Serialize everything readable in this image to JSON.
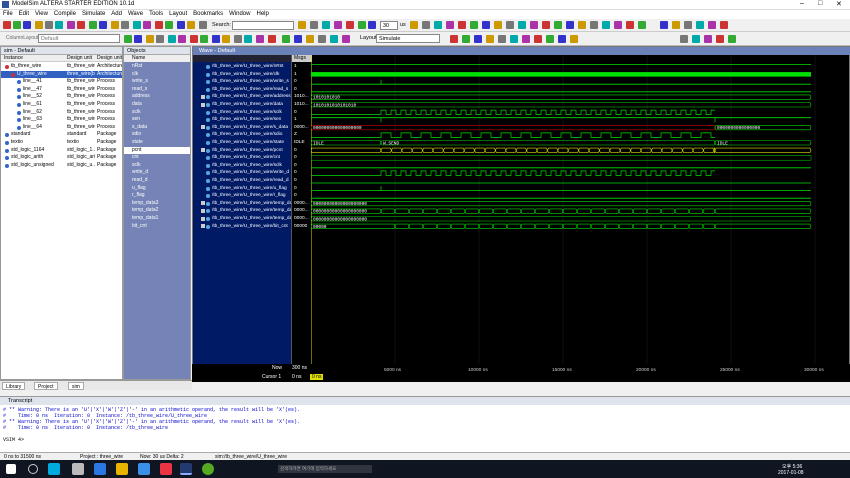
{
  "window": {
    "title": "ModelSim ALTERA STARTER EDITION 10.1d"
  },
  "menu": [
    "File",
    "Edit",
    "View",
    "Compile",
    "Simulate",
    "Add",
    "Wave",
    "Tools",
    "Layout",
    "Bookmarks",
    "Window",
    "Help"
  ],
  "toolbar": {
    "search_label": "Search:",
    "run_length": "30",
    "run_unit": "us",
    "column_layout": "ColumnLayout",
    "column_layout_value": "Default",
    "layout_label": "Layout",
    "layout_value": "Simulate"
  },
  "sim_panel": {
    "title": "sim - Default",
    "headers": [
      "Instance",
      "Design unit",
      "Design unit type"
    ],
    "rows": [
      {
        "name": "tb_three_wire",
        "unit": "tb_three_wire",
        "type": "Architecture",
        "indent": 0,
        "selected": false
      },
      {
        "name": "U_three_wire",
        "unit": "three_wire(b...",
        "type": "Architecture",
        "indent": 1,
        "selected": true
      },
      {
        "name": "line__41",
        "unit": "tb_three_wire",
        "type": "Process",
        "indent": 2,
        "selected": false
      },
      {
        "name": "line__47",
        "unit": "tb_three_wire",
        "type": "Process",
        "indent": 2,
        "selected": false
      },
      {
        "name": "line__52",
        "unit": "tb_three_wire",
        "type": "Process",
        "indent": 2,
        "selected": false
      },
      {
        "name": "line__61",
        "unit": "tb_three_wire",
        "type": "Process",
        "indent": 2,
        "selected": false
      },
      {
        "name": "line__62",
        "unit": "tb_three_wire",
        "type": "Process",
        "indent": 2,
        "selected": false
      },
      {
        "name": "line__63",
        "unit": "tb_three_wire",
        "type": "Process",
        "indent": 2,
        "selected": false
      },
      {
        "name": "line__64",
        "unit": "tb_three_wire",
        "type": "Process",
        "indent": 2,
        "selected": false
      },
      {
        "name": "standard",
        "unit": "standard",
        "type": "Package",
        "indent": 0,
        "selected": false
      },
      {
        "name": "textio",
        "unit": "textio",
        "type": "Package",
        "indent": 0,
        "selected": false
      },
      {
        "name": "std_logic_1164",
        "unit": "std_logic_1...",
        "type": "Package",
        "indent": 0,
        "selected": false
      },
      {
        "name": "std_logic_arith",
        "unit": "std_logic_arith",
        "type": "Package",
        "indent": 0,
        "selected": false
      },
      {
        "name": "std_logic_unsigned",
        "unit": "std_logic_u...",
        "type": "Package",
        "indent": 0,
        "selected": false
      }
    ],
    "tabs": [
      "Library",
      "Project",
      "sim"
    ]
  },
  "objects_panel": {
    "title": "Objects",
    "header": "Name",
    "items": [
      "nRst",
      "clk",
      "write_s",
      "read_s",
      "address",
      "data",
      "sclk",
      "sen",
      "s_data",
      "sdio",
      "state",
      "pcnt",
      "cnt",
      "sclk",
      "write_d",
      "read_d",
      "u_flag",
      "r_flag",
      "temp_data3",
      "temp_data2",
      "temp_data1",
      "bit_cnt"
    ],
    "selected_index": 11
  },
  "wave_panel": {
    "title": "Wave - Default",
    "msgs_header": "Msgs",
    "signals": [
      {
        "name": "/tb_three_wire/U_three_wire/nRst",
        "value": "1",
        "expand": false
      },
      {
        "name": "/tb_three_wire/U_three_wire/clk",
        "value": "1",
        "expand": false
      },
      {
        "name": "/tb_three_wire/U_three_wire/write_s",
        "value": "0",
        "expand": false
      },
      {
        "name": "/tb_three_wire/U_three_wire/read_s",
        "value": "0",
        "expand": false
      },
      {
        "name": "/tb_three_wire/U_three_wire/address",
        "value": "1010...",
        "expand": true
      },
      {
        "name": "/tb_three_wire/U_three_wire/data",
        "value": "1010...",
        "expand": true
      },
      {
        "name": "/tb_three_wire/U_three_wire/sclk",
        "value": "0",
        "expand": false
      },
      {
        "name": "/tb_three_wire/U_three_wire/sen",
        "value": "1",
        "expand": false
      },
      {
        "name": "/tb_three_wire/U_three_wire/s_data",
        "value": "0000...",
        "expand": true
      },
      {
        "name": "/tb_three_wire/U_three_wire/sdio",
        "value": "Z",
        "expand": false
      },
      {
        "name": "/tb_three_wire/U_three_wire/state",
        "value": "IDLE",
        "expand": false
      },
      {
        "name": "/tb_three_wire/U_three_wire/pcnt",
        "value": "0",
        "expand": true
      },
      {
        "name": "/tb_three_wire/U_three_wire/cnt",
        "value": "0",
        "expand": false
      },
      {
        "name": "/tb_three_wire/U_three_wire/sclk",
        "value": "0",
        "expand": false
      },
      {
        "name": "/tb_three_wire/U_three_wire/write_d",
        "value": "0",
        "expand": false
      },
      {
        "name": "/tb_three_wire/U_three_wire/read_d",
        "value": "0",
        "expand": false
      },
      {
        "name": "/tb_three_wire/U_three_wire/u_flag",
        "value": "0",
        "expand": false
      },
      {
        "name": "/tb_three_wire/U_three_wire/r_flag",
        "value": "0",
        "expand": false
      },
      {
        "name": "/tb_three_wire/U_three_wire/temp_data3",
        "value": "0000...",
        "expand": true
      },
      {
        "name": "/tb_three_wire/U_three_wire/temp_data2",
        "value": "0000...",
        "expand": true
      },
      {
        "name": "/tb_three_wire/U_three_wire/temp_data1",
        "value": "0000...",
        "expand": true
      },
      {
        "name": "/tb_three_wire/U_three_wire/bit_cnt",
        "value": "00000",
        "expand": true
      }
    ],
    "bus_labels": {
      "address": "1010101010",
      "data": "1010101010101010",
      "s_data": "000000000000000000",
      "s_data_end": "0000000000000000",
      "state_a": "IDLE",
      "state_b": "W_SEND",
      "state_c": "IDLE",
      "temp_data3": "00000000000000000000",
      "temp_data2": "00000000000000000000",
      "temp_data1": "00000000000000000000",
      "bit_cnt": "00000"
    },
    "now_label": "Now",
    "now_value": "300 ns",
    "cursor_label": "Cursor 1",
    "cursor_value": "0 ns",
    "cursor_marker": "0 ns",
    "time_ticks": [
      "5000 ns",
      "10000 ns",
      "15000 ns",
      "20000 ns",
      "25000 ns",
      "30000 ns"
    ]
  },
  "transcript": {
    "title": "Transcript",
    "lines": [
      "# ** Warning: There is an 'U'|'X'|'W'|'Z'|'-' in an arithmetic operand, the result will be 'X'(es).",
      "#    Time: 0 ns  Iteration: 0  Instance: /tb_three_wire/U_three_wire",
      "# ** Warning: There is an 'U'|'X'|'W'|'Z'|'-' in an arithmetic operand, the result will be 'X'(es).",
      "#    Time: 0 ns  Iteration: 0  Instance: /tb_three_wire",
      "",
      "VSIM 4>"
    ]
  },
  "status_bar": {
    "range": "0 ns to 31500 ns",
    "project": "Project : three_wire",
    "now": "Now: 30 us  Delta: 2",
    "path": "sim:/tb_three_wire/U_three_wire"
  },
  "taskbar": {
    "search_hint": "검색하려면 여기에 입력하세요",
    "clock_time": "오후 5:36",
    "clock_date": "2017-01-08"
  },
  "colors": {
    "wave_green": "#00e000",
    "wave_yellow": "#e0e000",
    "wave_red": "#d00000",
    "cursor": "#e0e000"
  }
}
